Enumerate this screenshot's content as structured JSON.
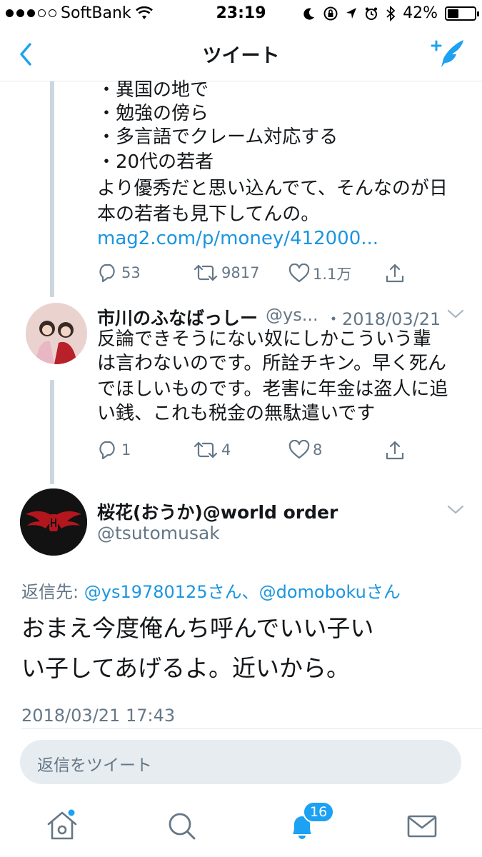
{
  "status_bar": {
    "carrier": "SoftBank",
    "time": "23:19",
    "battery": "42%",
    "battery_level": 0.42
  },
  "nav": {
    "title": "ツイート"
  },
  "tweet1": {
    "lines": [
      "・異国の地で",
      "・勉強の傍ら",
      "・多言語でクレーム対応する",
      "・20代の若者",
      "より優秀だと思い込んでて、そんなのが日",
      "本の若者も見下してんの。"
    ],
    "link": "mag2.com/p/money/412000...",
    "replies": "53",
    "retweets": "9817",
    "likes": "1.1万"
  },
  "tweet2": {
    "name": "市川のふなばっしー",
    "handle": "@ys...",
    "date": "・2018/03/21",
    "lines": [
      "反論できそうにない奴にしかこういう輩",
      "は言わないのです。所詮チキン。早く死ん",
      "でほしいものです。老害に年金は盗人に追",
      "い銭、これも税金の無駄遣いです"
    ],
    "replies": "1",
    "retweets": "4",
    "likes": "8"
  },
  "tweet3": {
    "name": "桜花(おうか)@world order",
    "handle": "@tsutomusak",
    "reply_to_label": "返信先:",
    "reply_to_users": "@ys19780125さん、@domobokuさん",
    "lines": [
      "おまえ今度俺んち呼んでいい子い",
      "い子してあげるよ。近いから。"
    ],
    "timestamp": "2018/03/21 17:43"
  },
  "reply_bar": {
    "placeholder": "返信をツイート"
  },
  "tab_bar": {
    "notifications_badge": "16"
  },
  "colors": {
    "accent": "#1da1f2",
    "link": "#1b95e0",
    "muted": "#657786"
  }
}
